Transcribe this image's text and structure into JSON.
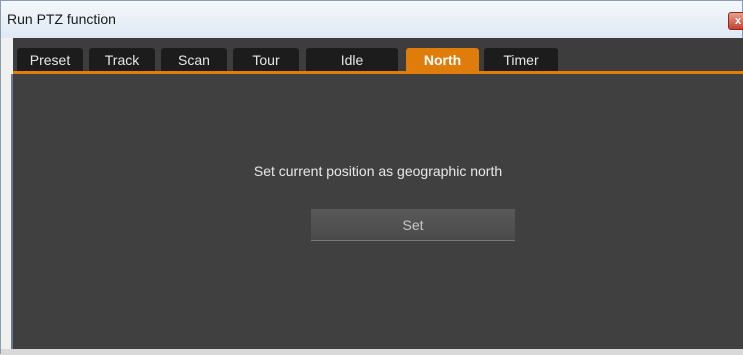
{
  "window": {
    "title": "Run PTZ function",
    "close_glyph": "x"
  },
  "tabs": [
    {
      "label": "Preset"
    },
    {
      "label": "Track"
    },
    {
      "label": "Scan"
    },
    {
      "label": "Tour"
    },
    {
      "label": "Idle"
    },
    {
      "label": "North",
      "active": true
    },
    {
      "label": "Timer"
    }
  ],
  "panel": {
    "message": "Set current position as geographic north",
    "set_button_label": "Set"
  },
  "colors": {
    "accent": "#e07c0a",
    "panel_bg": "#404040",
    "tab_bg": "#1c1c1c"
  },
  "icons": {
    "close": "close-icon"
  }
}
